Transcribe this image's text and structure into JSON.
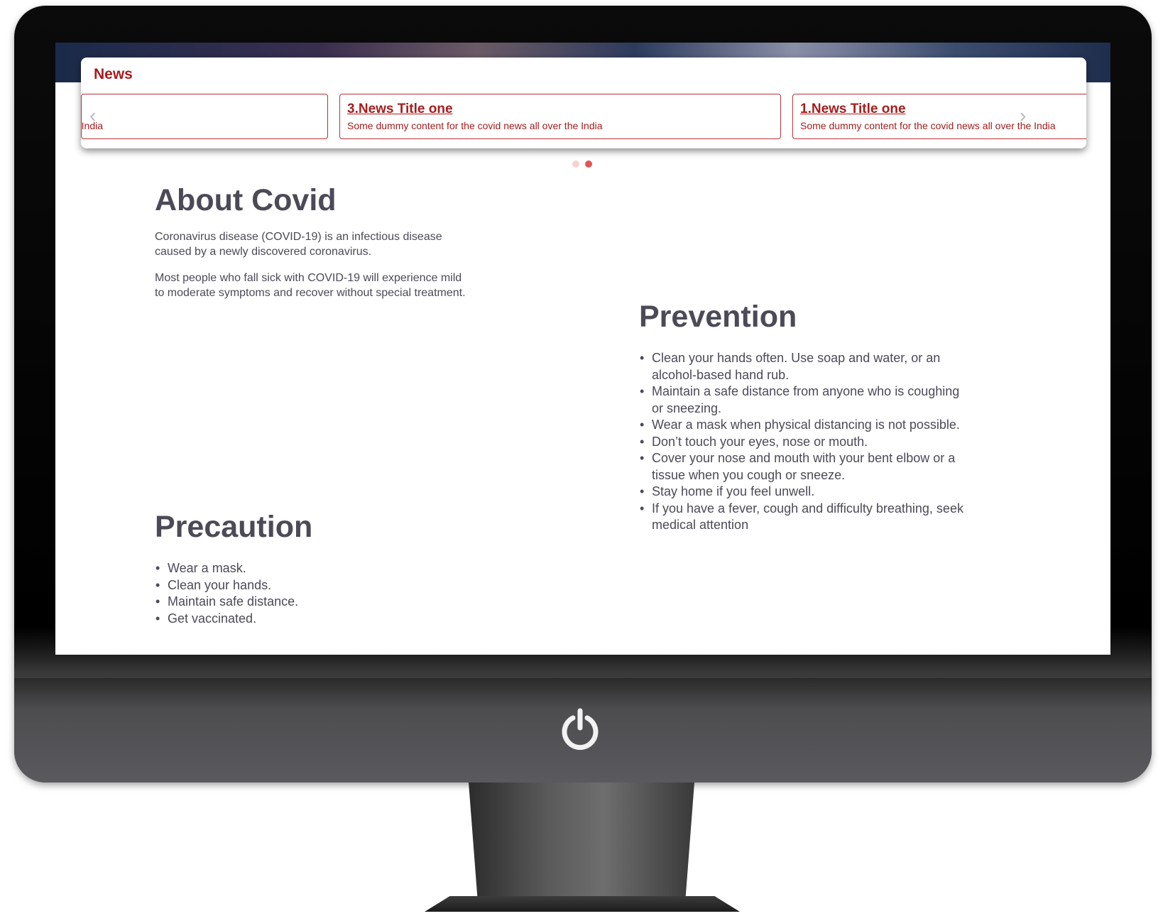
{
  "news": {
    "heading": "News",
    "items": [
      {
        "title": "",
        "description": "Some dummy content for the covid news all over the India"
      },
      {
        "title": "3.News Title one",
        "description": "Some dummy content for the covid news all over the India"
      },
      {
        "title": "1.News Title one",
        "description": "Some dummy content for the covid news all over the India"
      }
    ],
    "prev_icon": "chevron-left-icon",
    "next_icon": "chevron-right-icon",
    "pagination": {
      "count": 2,
      "active": 2
    },
    "colors": {
      "accent": "#a51d1d",
      "border": "#b8323a",
      "dot_active": "#e25555",
      "dot_inactive": "#f6d2d2"
    }
  },
  "about": {
    "title": "About Covid",
    "paragraphs": [
      "Coronavirus disease (COVID-19) is an infectious disease caused by a newly discovered coronavirus.",
      "Most people who fall sick with COVID-19 will experience mild to moderate symptoms and recover without special treatment."
    ]
  },
  "prevention": {
    "title": "Prevention",
    "items": [
      "Clean your hands often. Use soap and water, or an alcohol-based hand rub.",
      "Maintain a safe distance from anyone who is coughing or sneezing.",
      "Wear a mask when physical distancing is not possible.",
      "Don’t touch your eyes, nose or mouth.",
      "Cover your nose and mouth with your bent elbow or a tissue when you cough or sneeze.",
      "Stay home if you feel unwell.",
      "If you have a fever, cough and difficulty breathing, seek medical attention"
    ]
  },
  "precaution": {
    "title": "Precaution",
    "items": [
      "Wear a mask.",
      "Clean your hands.",
      "Maintain safe distance.",
      "Get vaccinated."
    ]
  },
  "monitor": {
    "power_icon": "power-icon"
  }
}
